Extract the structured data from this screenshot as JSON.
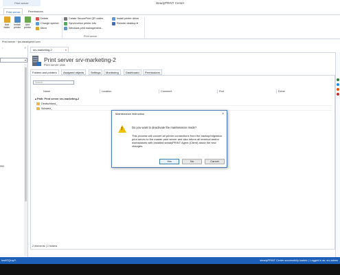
{
  "titlebar": {
    "context_tab": "Print server",
    "title": "steadyPRINT Center"
  },
  "ribbon": {
    "tabs": [
      "Print server",
      "Permissions"
    ],
    "big_buttons": [
      {
        "label": "Add folder",
        "icon": "add-folder-icon",
        "color": "#e0a62a"
      },
      {
        "label": "Install printer",
        "icon": "install-printer-icon",
        "color": "#4a8ac9"
      },
      {
        "label": "Add printer",
        "icon": "add-printer-icon",
        "color": "#6aa84f"
      }
    ],
    "group1_small": [
      "Delete",
      "Change symbol",
      "Move"
    ],
    "group2_small": [
      "Create SecurePrint QR codes",
      "Synchronize printer info",
      "Windows print management..."
    ],
    "group3_small": [
      "Install printer driver",
      "Remote desktop"
    ],
    "group_label": "Print server"
  },
  "addressbar": {
    "path": "Print server  ›  tps.steadyprint.com"
  },
  "leftpanel": {
    "stray_text": "052"
  },
  "doc_tab": {
    "label": "srv-marketing-2"
  },
  "main": {
    "title": "Print server srv-marketing-2",
    "subtitle": "Print server view",
    "tabs": [
      "Folders and printers",
      "Assigned objects",
      "Settings",
      "Monitoring",
      "Dashboard",
      "Permissions"
    ],
    "search_placeholder": "Search",
    "columns": [
      "Name",
      "Location",
      "Comment",
      "Port",
      "Driver"
    ],
    "group_row": "Path:  Print server  srv-marketing-2",
    "rows": [
      "Deutschland_",
      "Schweiz_"
    ],
    "status": "2 elements | 2 folders"
  },
  "dialog": {
    "title": "Maintenance instruction",
    "question": "Do you want to deactivate the maintenance mode?",
    "body": "This process will convert all printer connections from the backup/migration print server to the master print server and also inform all terminal and/or workstations with installed steadyPRINT Agent (Client) about the new changes.",
    "buttons": {
      "yes": "Yes",
      "no": "No",
      "cancel": "Cancel"
    }
  },
  "statusbar": {
    "left": "Inst\\SQLsp*\\",
    "right": "steadyPRINT Center successfully loaded. | Logged in as: srv-admin"
  },
  "colors": {
    "accent": "#1c5fb8",
    "warning": "#f2c200",
    "folder": "#e8b84a"
  }
}
